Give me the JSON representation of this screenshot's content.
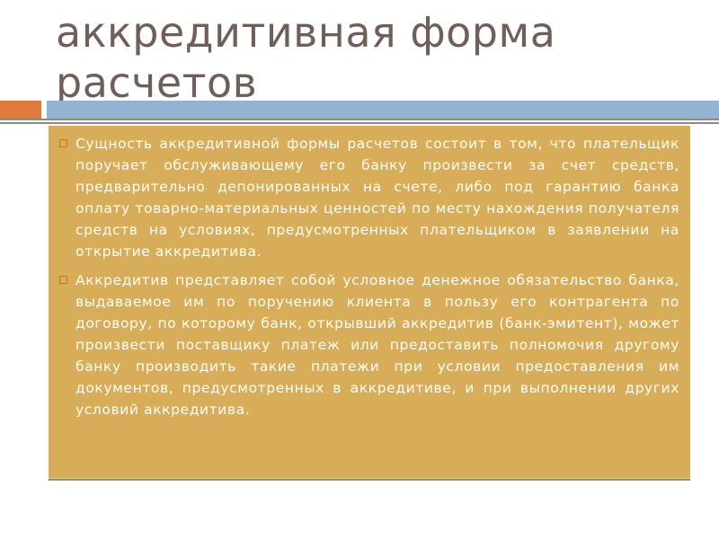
{
  "slide": {
    "title": "аккредитивная форма расчетов",
    "bullets": [
      {
        "icon": "square-bullet-icon",
        "text": "Сущность аккредитивной формы расчетов состоит в том, что плательщик поручает обслуживающему его банку произвести за счет средств, предварительно депонированных на счете, либо под гарантию банка оплату товарно-материальных ценностей по месту нахождения получателя средств на условиях, предусмотренных плательщиком в заявлении на открытие аккредитива."
      },
      {
        "icon": "square-bullet-icon",
        "text": "Аккредитив представляет собой условное денежное обязательство банка, выдаваемое им по поручению клиента в пользу его контрагента по договору, по которому банк, открывший аккредитив (банк-эмитент), может произвести поставщику платеж или предоставить полномочия другому банку производить такие платежи при условии предоставления им документов, предусмотренных в аккредитиве, и при выполнении других условий аккредитива."
      }
    ]
  },
  "colors": {
    "title_text": "#6f5f58",
    "accent_orange": "#e07a3c",
    "accent_blue": "#93b3d3",
    "rule_gray": "#8c8c86",
    "content_background": "#d8ad5a",
    "content_text": "#fffdf4"
  }
}
